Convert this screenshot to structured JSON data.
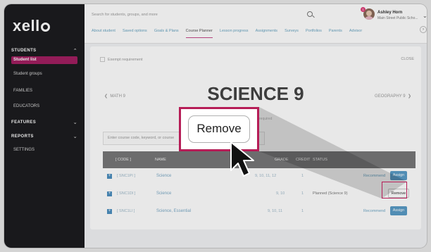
{
  "logo": "xello",
  "sidebar": {
    "sections": [
      {
        "label": "STUDENTS",
        "chevron": "chevron-up-icon"
      },
      {
        "label": "FEATURES",
        "chevron": "chevron-down-icon"
      },
      {
        "label": "REPORTS",
        "chevron": "chevron-down-icon"
      }
    ],
    "items": [
      {
        "label": "Student list",
        "active": true
      },
      {
        "label": "Student groups"
      },
      {
        "label": "FAMILIES"
      },
      {
        "label": "EDUCATORS"
      },
      {
        "label": "SETTINGS"
      }
    ]
  },
  "topbar": {
    "search_placeholder": "Search for students, groups, and more",
    "user_name": "Ashley Horn",
    "user_school": "Main Street Public Scho...",
    "badge_count": "1",
    "tabs": [
      "About student",
      "Saved options",
      "Goals & Plans",
      "Course Planner",
      "Lesson progress",
      "Assignments",
      "Surveys",
      "Portfolios",
      "Parents",
      "Advisor"
    ],
    "active_tab": "Course Planner"
  },
  "content": {
    "exempt_label": "Exempt requirement",
    "close_label": "CLOSE",
    "prev_course": "MATH 9",
    "course_title": "SCIENCE 9",
    "next_course": "GEOGRAPHY 9",
    "hint": "required",
    "course_input_placeholder": "Enter course code, keyword, or course",
    "table": {
      "headers": {
        "code": "[ CODE ]",
        "name": "NAME",
        "grade": "GRADE",
        "credit": "CREDIT",
        "status": "STATUS"
      },
      "rows": [
        {
          "code": "[ SNC1PI ]",
          "name": "Science",
          "grade": "9, 10, 11, 12",
          "credit": "1",
          "status": "",
          "action_label": "Recommend",
          "button": "Assign"
        },
        {
          "code": "[ SNC1DI ]",
          "name": "Science",
          "grade": "9, 10",
          "credit": "1",
          "status": "Planned (Science 9)",
          "action_label": "",
          "button": "Remove"
        },
        {
          "code": "[ SNC1LI ]",
          "name": "Science, Essential",
          "grade": "9, 10, 11",
          "credit": "1",
          "status": "",
          "action_label": "Recommend",
          "button": "Assign"
        }
      ]
    }
  },
  "callout": {
    "label": "Remove"
  },
  "colors": {
    "accent": "#b61d57",
    "sidebar_bg": "#1c1c1f",
    "active_nav": "#a21f61",
    "assign_button": "#5a9cc6"
  }
}
